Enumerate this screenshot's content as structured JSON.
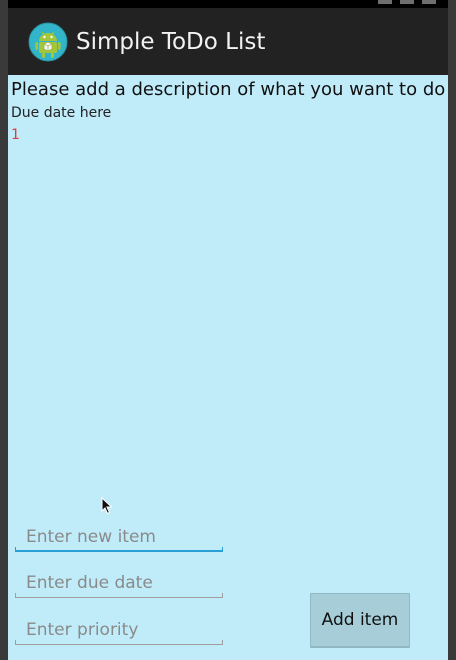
{
  "app": {
    "title": "Simple ToDo List",
    "icon": "android-app-icon"
  },
  "labels": {
    "description": "Please add a description of what you want to do",
    "due_date": "Due date here",
    "priority": "1"
  },
  "form": {
    "new_item_placeholder": "Enter new item",
    "due_date_placeholder": "Enter due date",
    "priority_placeholder": "Enter priority",
    "add_button_label": "Add item"
  },
  "colors": {
    "content_bg": "#c0ecfa",
    "app_bar_bg": "#222222",
    "priority_text": "#e23b3b",
    "focus_underline": "#2a9fd6",
    "button_bg": "#a6cdd8"
  }
}
